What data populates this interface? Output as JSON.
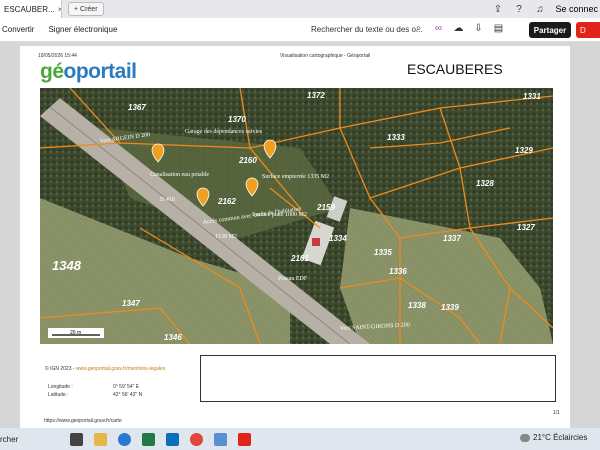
{
  "browser": {
    "tab_title": "ESCAUBER...",
    "new_button": "+ Créer",
    "profile_label": "Se connec",
    "toolbar": {
      "convert": "Convertir",
      "sign": "Signer électronique",
      "search": "Rechercher du texte ou des o...",
      "share": "Partager",
      "red_button": "D"
    }
  },
  "document": {
    "date": "19/05/2026 15:44",
    "header_title": "Visualisation cartographique - Géoportail",
    "logo_geo": "gé",
    "logo_portail": "oportail",
    "commune": "ESCAUBERES",
    "map_labels": {
      "parcels": [
        "1367",
        "1370",
        "1372",
        "1331",
        "1333",
        "1329",
        "1328",
        "1327",
        "1337",
        "1335",
        "1336",
        "1334",
        "2159",
        "2161",
        "2160",
        "2162",
        "1347",
        "1346",
        "1348",
        "1338",
        "1339"
      ],
      "road_north": "Vers ARGEIN D 200",
      "road_south": "Vers SAINT-GIRONS D 200",
      "garage": "Garage des dépendances suivies",
      "sanitation": "Canalisation eau potable",
      "surface_gravel": "Surface empierrée 1335 m2",
      "surface_flat": "Surface plate 1000 M2",
      "access": "Accès commun avec cours de l'habitation",
      "poteau": "Poteau EDF",
      "area_2": "1530 M2",
      "road_code": "D 418",
      "scale": "20 m"
    },
    "ign": "© IGN 2023 -",
    "ign_link": "www.geoportail.gouv.fr/mentions-legales",
    "longitude_label": "Longitude :",
    "longitude_value": "0° 59' 54\" E",
    "latitude_label": "Latitude :",
    "latitude_value": "42° 56' 43\" N",
    "url": "https://www.geoportail.gouv.fr/carte",
    "page_number": "1/1"
  },
  "taskbar": {
    "search": "rcher",
    "weather": "21°C Éclaircies",
    "icon_colors": [
      "#444",
      "#2b78d4",
      "#1f7a48",
      "#0b6fb8",
      "#e7a21d",
      "#5b8fd4",
      "#e0241a"
    ]
  }
}
